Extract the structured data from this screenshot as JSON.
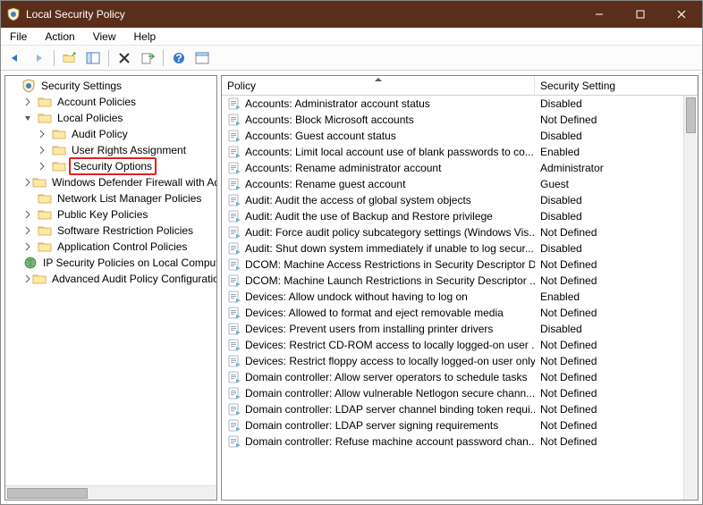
{
  "title": "Local Security Policy",
  "menu": {
    "file": "File",
    "action": "Action",
    "view": "View",
    "help": "Help"
  },
  "toolbar": {
    "back": "back",
    "forward": "forward",
    "up": "up",
    "show": "show",
    "delete": "delete",
    "export": "export",
    "refresh": "refresh",
    "help": "help",
    "props": "props"
  },
  "tree": {
    "root": "Security Settings",
    "nodes": [
      {
        "label": "Account Policies",
        "depth": 1,
        "expand": ">"
      },
      {
        "label": "Local Policies",
        "depth": 1,
        "expand": "v"
      },
      {
        "label": "Audit Policy",
        "depth": 2,
        "expand": ">"
      },
      {
        "label": "User Rights Assignment",
        "depth": 2,
        "expand": ">"
      },
      {
        "label": "Security Options",
        "depth": 2,
        "expand": ">",
        "selected": true
      },
      {
        "label": "Windows Defender Firewall with Adva",
        "depth": 1,
        "expand": ">"
      },
      {
        "label": "Network List Manager Policies",
        "depth": 1,
        "expand": ""
      },
      {
        "label": "Public Key Policies",
        "depth": 1,
        "expand": ">"
      },
      {
        "label": "Software Restriction Policies",
        "depth": 1,
        "expand": ">"
      },
      {
        "label": "Application Control Policies",
        "depth": 1,
        "expand": ">"
      },
      {
        "label": "IP Security Policies on Local Compute",
        "depth": 1,
        "expand": "",
        "ip": true
      },
      {
        "label": "Advanced Audit Policy Configuration",
        "depth": 1,
        "expand": ">"
      }
    ]
  },
  "list": {
    "col_policy": "Policy",
    "col_setting": "Security Setting",
    "rows": [
      {
        "policy": "Accounts: Administrator account status",
        "setting": "Disabled"
      },
      {
        "policy": "Accounts: Block Microsoft accounts",
        "setting": "Not Defined"
      },
      {
        "policy": "Accounts: Guest account status",
        "setting": "Disabled"
      },
      {
        "policy": "Accounts: Limit local account use of blank passwords to co...",
        "setting": "Enabled"
      },
      {
        "policy": "Accounts: Rename administrator account",
        "setting": "Administrator"
      },
      {
        "policy": "Accounts: Rename guest account",
        "setting": "Guest"
      },
      {
        "policy": "Audit: Audit the access of global system objects",
        "setting": "Disabled"
      },
      {
        "policy": "Audit: Audit the use of Backup and Restore privilege",
        "setting": "Disabled"
      },
      {
        "policy": "Audit: Force audit policy subcategory settings (Windows Vis...",
        "setting": "Not Defined"
      },
      {
        "policy": "Audit: Shut down system immediately if unable to log secur...",
        "setting": "Disabled"
      },
      {
        "policy": "DCOM: Machine Access Restrictions in Security Descriptor D...",
        "setting": "Not Defined"
      },
      {
        "policy": "DCOM: Machine Launch Restrictions in Security Descriptor ...",
        "setting": "Not Defined"
      },
      {
        "policy": "Devices: Allow undock without having to log on",
        "setting": "Enabled"
      },
      {
        "policy": "Devices: Allowed to format and eject removable media",
        "setting": "Not Defined"
      },
      {
        "policy": "Devices: Prevent users from installing printer drivers",
        "setting": "Disabled"
      },
      {
        "policy": "Devices: Restrict CD-ROM access to locally logged-on user ...",
        "setting": "Not Defined"
      },
      {
        "policy": "Devices: Restrict floppy access to locally logged-on user only",
        "setting": "Not Defined"
      },
      {
        "policy": "Domain controller: Allow server operators to schedule tasks",
        "setting": "Not Defined"
      },
      {
        "policy": "Domain controller: Allow vulnerable Netlogon secure chann...",
        "setting": "Not Defined"
      },
      {
        "policy": "Domain controller: LDAP server channel binding token requi...",
        "setting": "Not Defined"
      },
      {
        "policy": "Domain controller: LDAP server signing requirements",
        "setting": "Not Defined"
      },
      {
        "policy": "Domain controller: Refuse machine account password chan...",
        "setting": "Not Defined"
      }
    ]
  }
}
